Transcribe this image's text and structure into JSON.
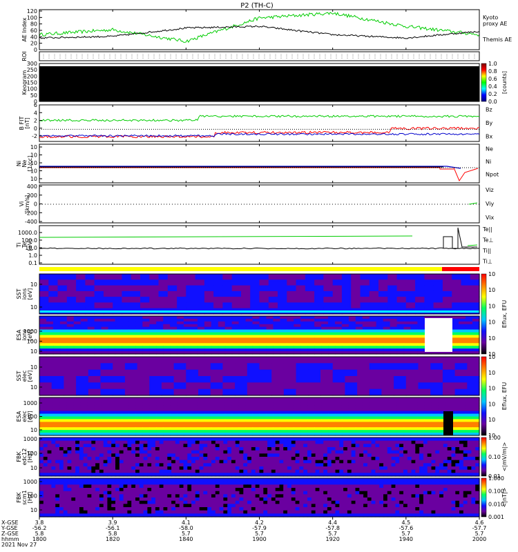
{
  "title": "P2 (TH-C)",
  "ae_panel": {
    "ylabel": "AE Index",
    "yticks": [
      "120",
      "100",
      "80",
      "60",
      "40",
      "20",
      "0"
    ],
    "legend_kyoto": [
      "Kyoto",
      "proxy AE"
    ],
    "legend_themis": "Themis AE",
    "kyoto_color": "#00cc00",
    "themis_color": "#000000"
  },
  "roi_label": "ROI",
  "keogram": {
    "ylabel": "Keogram",
    "yticks": [
      "300",
      "250",
      "200",
      "150",
      "100",
      "50",
      "0"
    ],
    "cbar_ticks": [
      "1.0",
      "0.8",
      "0.6",
      "0.4",
      "0.2",
      "0.0"
    ],
    "cbar_label": "[counts]"
  },
  "bfield": {
    "ylabel": [
      "B FIT",
      "[nT]"
    ],
    "yticks": [
      "6",
      "4",
      "2",
      "0",
      "-2"
    ],
    "legend": [
      {
        "label": "Bz",
        "color": "#ff0000"
      },
      {
        "label": "By",
        "color": "#00cc00"
      },
      {
        "label": "Bx",
        "color": "#0000cc"
      }
    ]
  },
  "density": {
    "ylabel": [
      "Ni",
      "Ne",
      "[1/cc]"
    ],
    "yticks": [
      "10",
      "10",
      "10",
      "10",
      "10"
    ],
    "legend": [
      {
        "label": "Ne",
        "color": "#ff0000"
      },
      {
        "label": "Ni",
        "color": "#000000"
      },
      {
        "label": "Npot",
        "color": "#0000cc"
      }
    ]
  },
  "velocity": {
    "ylabel": [
      "Vi",
      "[km/s]"
    ],
    "yticks": [
      "400",
      "200",
      "0",
      "-200",
      "-400"
    ],
    "legend": [
      {
        "label": "Viz",
        "color": "#ff0000"
      },
      {
        "label": "Viy",
        "color": "#00cc00"
      },
      {
        "label": "Vix",
        "color": "#0000cc"
      }
    ]
  },
  "temperature": {
    "ylabel": [
      "Ti",
      "Te",
      "[eV]"
    ],
    "yticks": [
      "1000.0",
      "100.0",
      "10.0",
      "1.0",
      "0.1"
    ],
    "legend": [
      {
        "label": "Te||",
        "color": "#000000"
      },
      {
        "label": "Te⊥",
        "color": "#ff0000"
      },
      {
        "label": "Ti||",
        "color": "#00cc00"
      },
      {
        "label": "Ti⊥",
        "color": "#0000cc"
      }
    ]
  },
  "sst_i": {
    "ylabel": [
      "SST",
      "ions",
      "[eV]"
    ],
    "yticks": [
      "10",
      "10"
    ]
  },
  "esa_i": {
    "ylabel": [
      "ESA",
      "ions",
      "[eV]"
    ],
    "yticks": [
      "1000",
      "100",
      "10"
    ]
  },
  "sst_e": {
    "ylabel": [
      "SST",
      "elec",
      "[eV]"
    ],
    "yticks": [
      "10",
      "10"
    ]
  },
  "esa_e": {
    "ylabel": [
      "ESA",
      "elec",
      "[eV]"
    ],
    "yticks": [
      "1000",
      "100",
      "10"
    ]
  },
  "eflux_cbar": {
    "ticks": [
      "10",
      "10",
      "10",
      "10",
      "10",
      "10"
    ],
    "label": "Eflux, EFU"
  },
  "fbk_e": {
    "ylabel": [
      "FBK",
      "edc12",
      "[Hz]"
    ],
    "yticks": [
      "1000",
      "100",
      "10"
    ]
  },
  "fbk_b": {
    "ylabel": [
      "FBK",
      "scm1",
      "[Hz]"
    ],
    "yticks": [
      "1000",
      "100",
      "10"
    ]
  },
  "fbk_cbar_e": {
    "ticks": [
      "1.00",
      "0.10",
      "0.01"
    ],
    "label": "<|mV/m|>"
  },
  "fbk_cbar_b": {
    "ticks": [
      "1.000",
      "0.100",
      "0.010",
      "0.001"
    ],
    "label": "<|nT|>"
  },
  "footer": {
    "row_labels": [
      "X-GSE",
      "Y-GSE",
      "Z-GSE",
      "hhmm",
      "2021 Nov 27"
    ],
    "columns": [
      {
        "vals": [
          "3.8",
          "-56.2",
          "5.8",
          "1800"
        ]
      },
      {
        "vals": [
          "3.9",
          "-56.1",
          "5.8",
          "1820"
        ]
      },
      {
        "vals": [
          "4.1",
          "-58.0",
          "5.7",
          "1840"
        ]
      },
      {
        "vals": [
          "4.2",
          "-57.9",
          "5.7",
          "1900"
        ]
      },
      {
        "vals": [
          "4.4",
          "-57.8",
          "5.7",
          "1920"
        ]
      },
      {
        "vals": [
          "4.5",
          "-57.6",
          "5.7",
          "1940"
        ]
      },
      {
        "vals": [
          "4.6",
          "-57.7",
          "5.7",
          "2000"
        ]
      }
    ]
  },
  "chart_data": {
    "type": "line",
    "title": "P2 (TH-C)",
    "x": [
      "1800",
      "1820",
      "1840",
      "1900",
      "1920",
      "1940",
      "2000"
    ],
    "xlabel": "hhmm",
    "series": [
      {
        "name": "Kyoto proxy AE",
        "values": [
          45,
          60,
          25,
          95,
          110,
          70,
          45
        ]
      },
      {
        "name": "Themis AE",
        "values": [
          35,
          40,
          65,
          70,
          45,
          35,
          55
        ]
      }
    ],
    "ylim": [
      0,
      120
    ]
  }
}
